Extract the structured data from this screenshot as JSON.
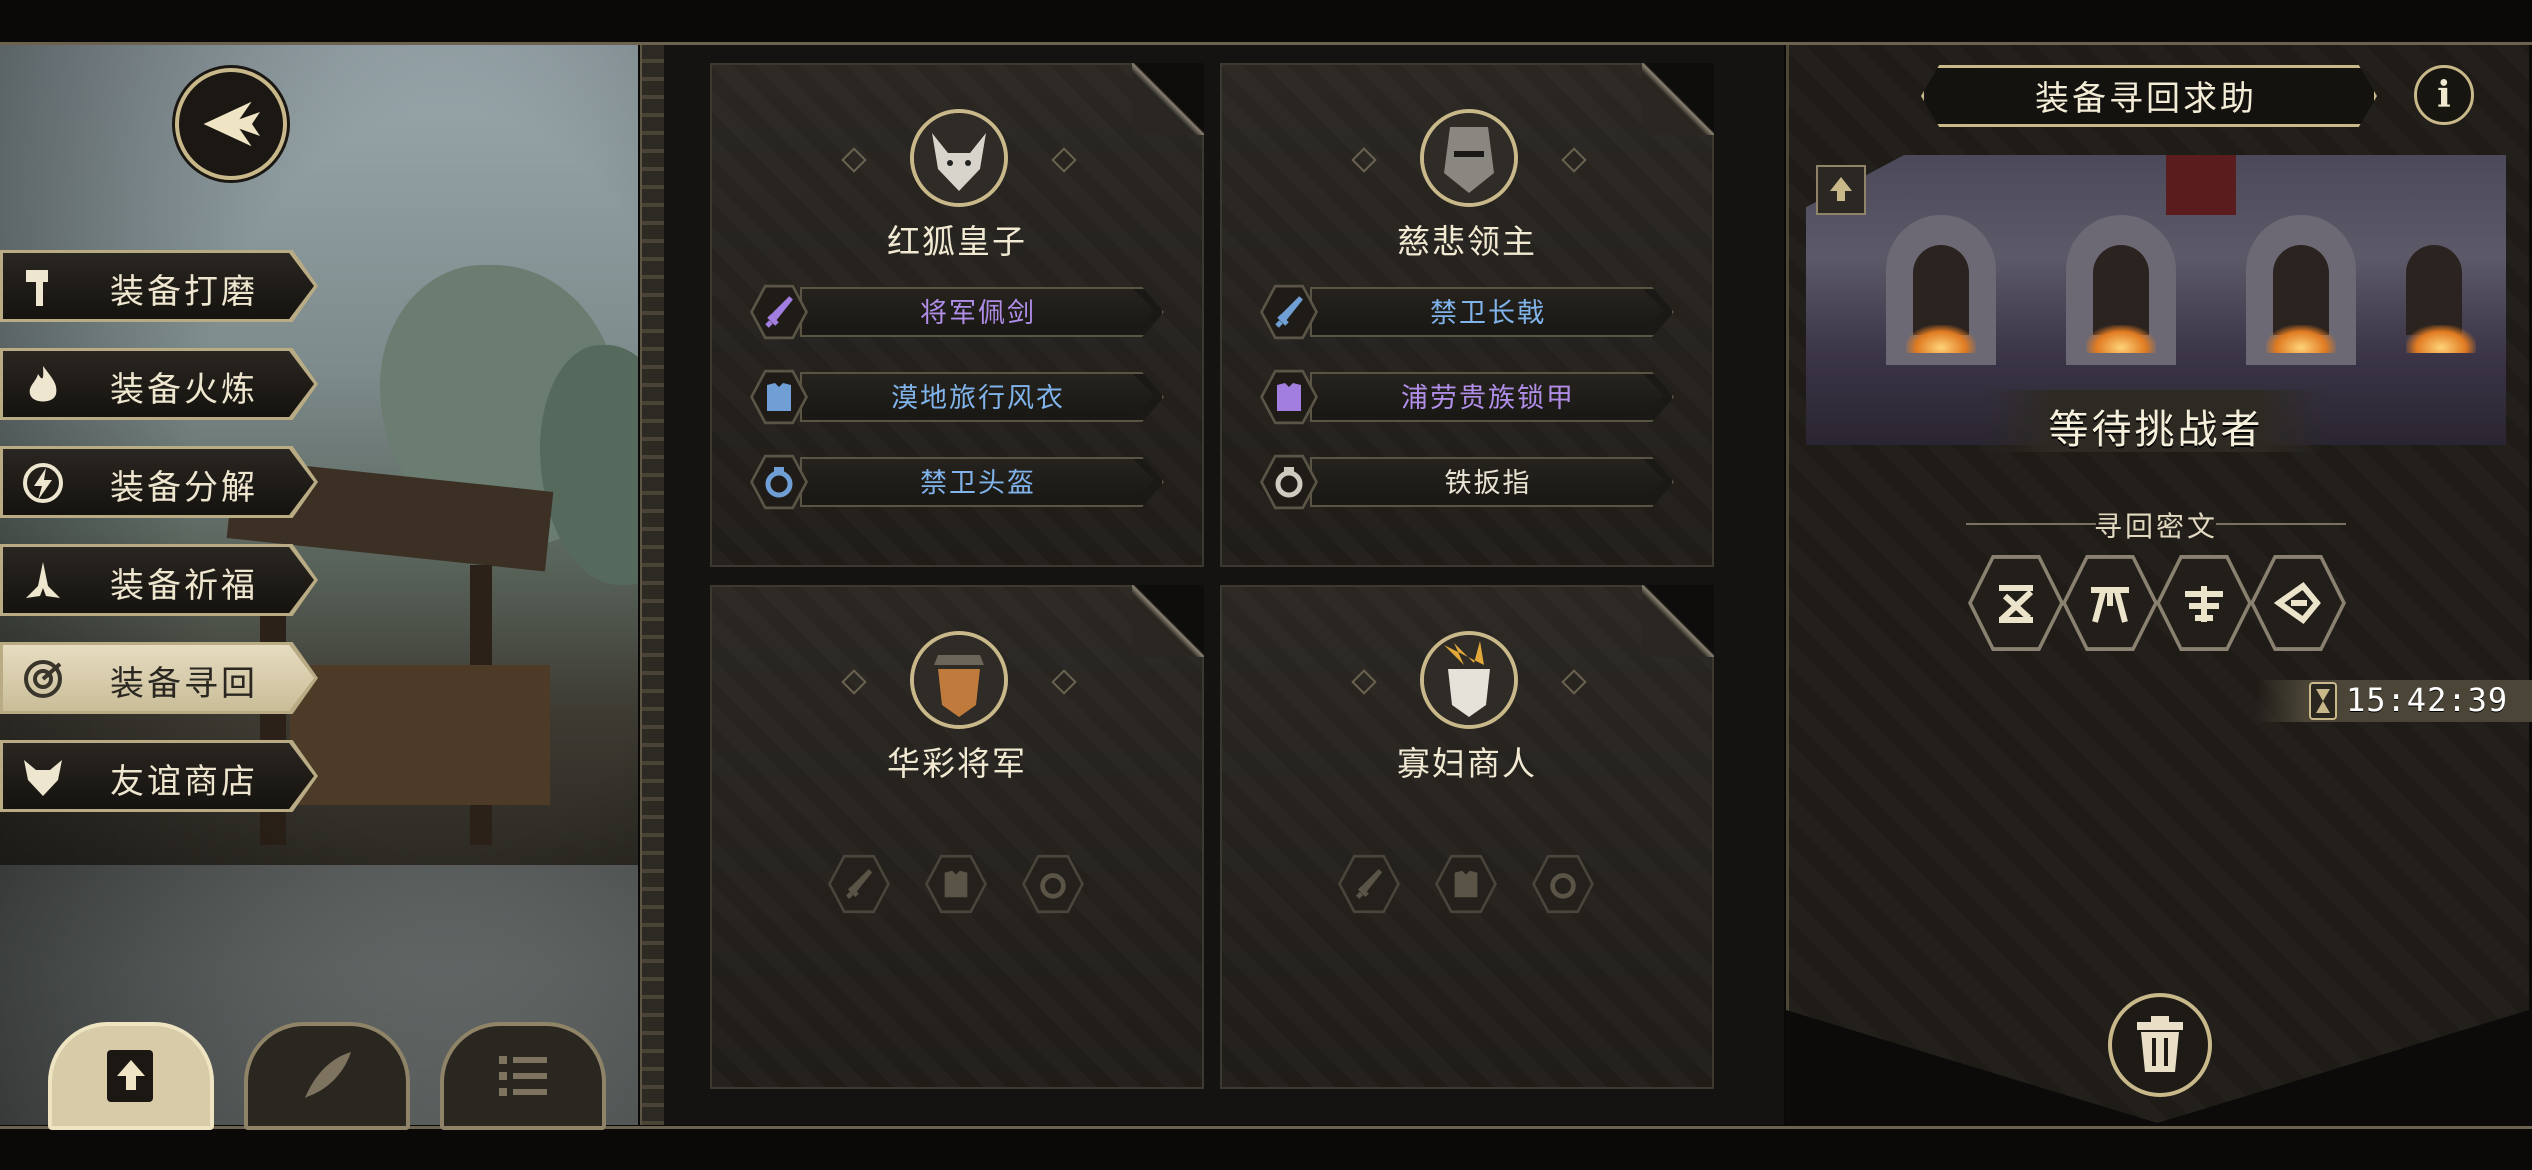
{
  "menu": {
    "items": [
      {
        "label": "装备打磨",
        "icon": "hammer-icon",
        "active": false
      },
      {
        "label": "装备火炼",
        "icon": "flame-icon",
        "active": false
      },
      {
        "label": "装备分解",
        "icon": "lightning-icon",
        "active": false
      },
      {
        "label": "装备祈福",
        "icon": "praying-hands-icon",
        "active": false
      },
      {
        "label": "装备寻回",
        "icon": "target-icon",
        "active": true
      },
      {
        "label": "友谊商店",
        "icon": "fox-icon",
        "active": false
      }
    ]
  },
  "bottom_buttons": [
    {
      "icon": "upload-icon",
      "active": true
    },
    {
      "icon": "feather-icon",
      "active": false
    },
    {
      "icon": "list-icon",
      "active": false
    }
  ],
  "cards": [
    {
      "name": "红狐皇子",
      "items": [
        {
          "label": "将军佩剑",
          "type": "sword",
          "color": "#b08ee8"
        },
        {
          "label": "漠地旅行风衣",
          "type": "armor",
          "color": "#7fb3ea"
        },
        {
          "label": "禁卫头盔",
          "type": "ring",
          "color": "#7fb3ea"
        }
      ]
    },
    {
      "name": "慈悲领主",
      "items": [
        {
          "label": "禁卫长戟",
          "type": "sword",
          "color": "#7fb3ea"
        },
        {
          "label": "浦劳贵族锁甲",
          "type": "armor",
          "color": "#b08ee8"
        },
        {
          "label": "铁扳指",
          "type": "ring",
          "color": "#e8e2d2"
        }
      ]
    },
    {
      "name": "华彩将军",
      "items": []
    },
    {
      "name": "寡妇商人",
      "items": []
    }
  ],
  "panel": {
    "title": "装备寻回求助",
    "info_label": "i",
    "status": "等待挑战者",
    "rune_title": "寻回密文",
    "runes": [
      "rune-1-icon",
      "rune-2-icon",
      "rune-3-icon",
      "rune-4-icon"
    ],
    "timer": "15:42:39"
  },
  "colors": {
    "gold": "#c9b98a",
    "purple": "#b08ee8",
    "blue": "#7fb3ea",
    "white": "#e8e2d2"
  }
}
